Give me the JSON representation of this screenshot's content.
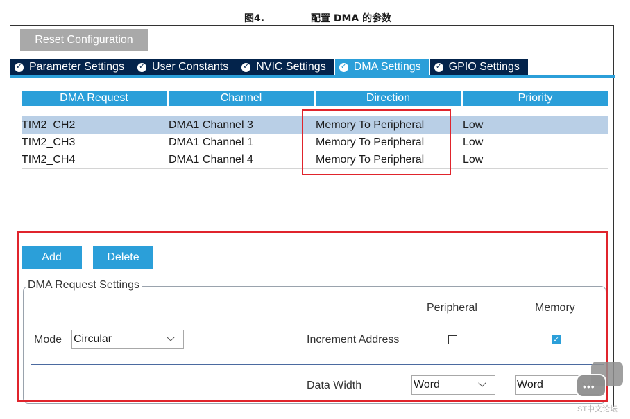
{
  "caption": {
    "figure_number": "图4.",
    "title": "配置 DMA 的参数"
  },
  "toolbar": {
    "reset_label": "Reset Configuration"
  },
  "tabs": [
    {
      "label": "Parameter Settings",
      "active": false
    },
    {
      "label": "User Constants",
      "active": false
    },
    {
      "label": "NVIC Settings",
      "active": false
    },
    {
      "label": "DMA Settings",
      "active": true
    },
    {
      "label": "GPIO Settings",
      "active": false
    }
  ],
  "dma_table": {
    "columns": [
      "DMA Request",
      "Channel",
      "Direction",
      "Priority"
    ],
    "rows": [
      {
        "request": "TIM2_CH2",
        "channel": "DMA1 Channel 3",
        "direction": "Memory To Peripheral",
        "priority": "Low",
        "selected": true
      },
      {
        "request": "TIM2_CH3",
        "channel": "DMA1 Channel 1",
        "direction": "Memory To Peripheral",
        "priority": "Low",
        "selected": false
      },
      {
        "request": "TIM2_CH4",
        "channel": "DMA1 Channel 4",
        "direction": "Memory To Peripheral",
        "priority": "Low",
        "selected": false
      }
    ]
  },
  "actions": {
    "add_label": "Add",
    "delete_label": "Delete"
  },
  "request_settings": {
    "legend": "DMA Request Settings",
    "peripheral_header": "Peripheral",
    "memory_header": "Memory",
    "mode_label": "Mode",
    "mode_value": "Circular",
    "increment_label": "Increment Address",
    "peripheral_increment": false,
    "memory_increment": true,
    "data_width_label": "Data Width",
    "peripheral_width": "Word",
    "memory_width": "Word"
  },
  "watermark": {
    "text": "ST中文论坛"
  },
  "colors": {
    "accent": "#2b9fd9",
    "tab_dark": "#03234b",
    "highlight_red": "#e0242c",
    "selected_row": "#b9cfe6"
  }
}
